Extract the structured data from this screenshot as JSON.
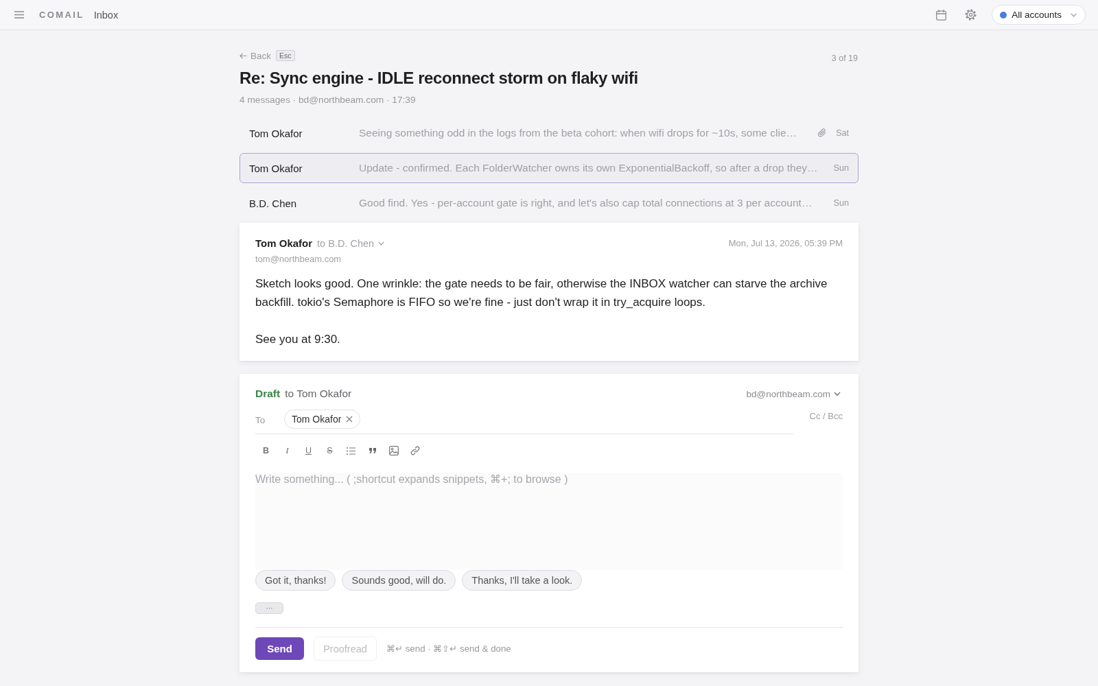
{
  "top_bar": {
    "brand": "COMAIL",
    "section": "Inbox",
    "account_selector": "All accounts"
  },
  "thread_header": {
    "back": "Back",
    "back_key": "Esc",
    "position": "3 of 19",
    "subject": "Re: Sync engine - IDLE reconnect storm on flaky wifi",
    "meta": "4 messages · bd@northbeam.com · 17:39"
  },
  "messages": [
    {
      "sender": "Tom Okafor",
      "snippet": "Seeing something odd in the logs from the beta cohort: when wifi drops for ~10s, some clie…",
      "attachment": true,
      "date": "Sat",
      "selected": false
    },
    {
      "sender": "Tom Okafor",
      "snippet": "Update - confirmed. Each FolderWatcher owns its own ExponentialBackoff, so after a drop they…",
      "attachment": false,
      "date": "Sun",
      "selected": true
    },
    {
      "sender": "B.D. Chen",
      "snippet": "Good find. Yes - per-account gate is right, and let's also cap total connections at 3 per account…",
      "attachment": false,
      "date": "Sun",
      "selected": false
    }
  ],
  "open_message": {
    "sender": "Tom Okafor",
    "recipients": "to B.D. Chen",
    "email": "tom@northbeam.com",
    "date": "Mon, Jul 13, 2026, 05:39 PM",
    "body": [
      "Sketch looks good. One wrinkle: the gate needs to be fair, otherwise the INBOX watcher can starve the archive backfill. tokio's Semaphore is FIFO so we're fine - just don't wrap it in try_acquire loops.",
      "See you at 9:30."
    ]
  },
  "draft": {
    "label": "Draft",
    "to_line": "to Tom Okafor",
    "from": "bd@northbeam.com",
    "to_label": "To",
    "recipients": [
      "Tom Okafor"
    ],
    "cc_bcc": "Cc / Bcc",
    "toolbar": [
      {
        "kind": "bold",
        "label": "B"
      },
      {
        "kind": "italic",
        "label": "I"
      },
      {
        "kind": "underline",
        "label": "U"
      },
      {
        "kind": "strike",
        "label": "S"
      },
      {
        "kind": "list"
      },
      {
        "kind": "quote"
      },
      {
        "kind": "image"
      },
      {
        "kind": "link"
      }
    ],
    "placeholder": "Write something... ( ;shortcut expands snippets, ⌘+; to browse )",
    "suggestions": [
      "Got it, thanks!",
      "Sounds good, will do.",
      "Thanks, I'll take a look."
    ],
    "more": "···",
    "send": "Send",
    "proofread": {
      "label": "Proofread",
      "disabled": true
    },
    "shortcut_hint": "⌘↵ send · ⌘⇧↵ send & done"
  }
}
